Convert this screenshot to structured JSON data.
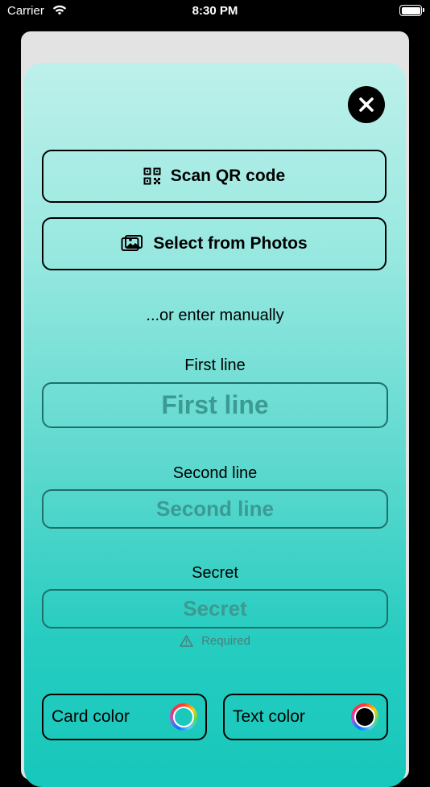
{
  "status_bar": {
    "carrier": "Carrier",
    "time": "8:30 PM"
  },
  "scan_button": {
    "label": "Scan QR code",
    "icon": "qr-code-icon"
  },
  "photos_button": {
    "label": "Select from Photos",
    "icon": "photos-icon"
  },
  "manual_hint": "...or enter manually",
  "fields": {
    "first_line": {
      "label": "First line",
      "placeholder": "First line"
    },
    "second_line": {
      "label": "Second line",
      "placeholder": "Second line"
    },
    "secret": {
      "label": "Secret",
      "placeholder": "Secret",
      "hint": "Required"
    }
  },
  "card_color": {
    "label": "Card color",
    "value": "#1cc8bb"
  },
  "text_color": {
    "label": "Text color",
    "value": "#000000"
  },
  "close_icon": "close-icon"
}
